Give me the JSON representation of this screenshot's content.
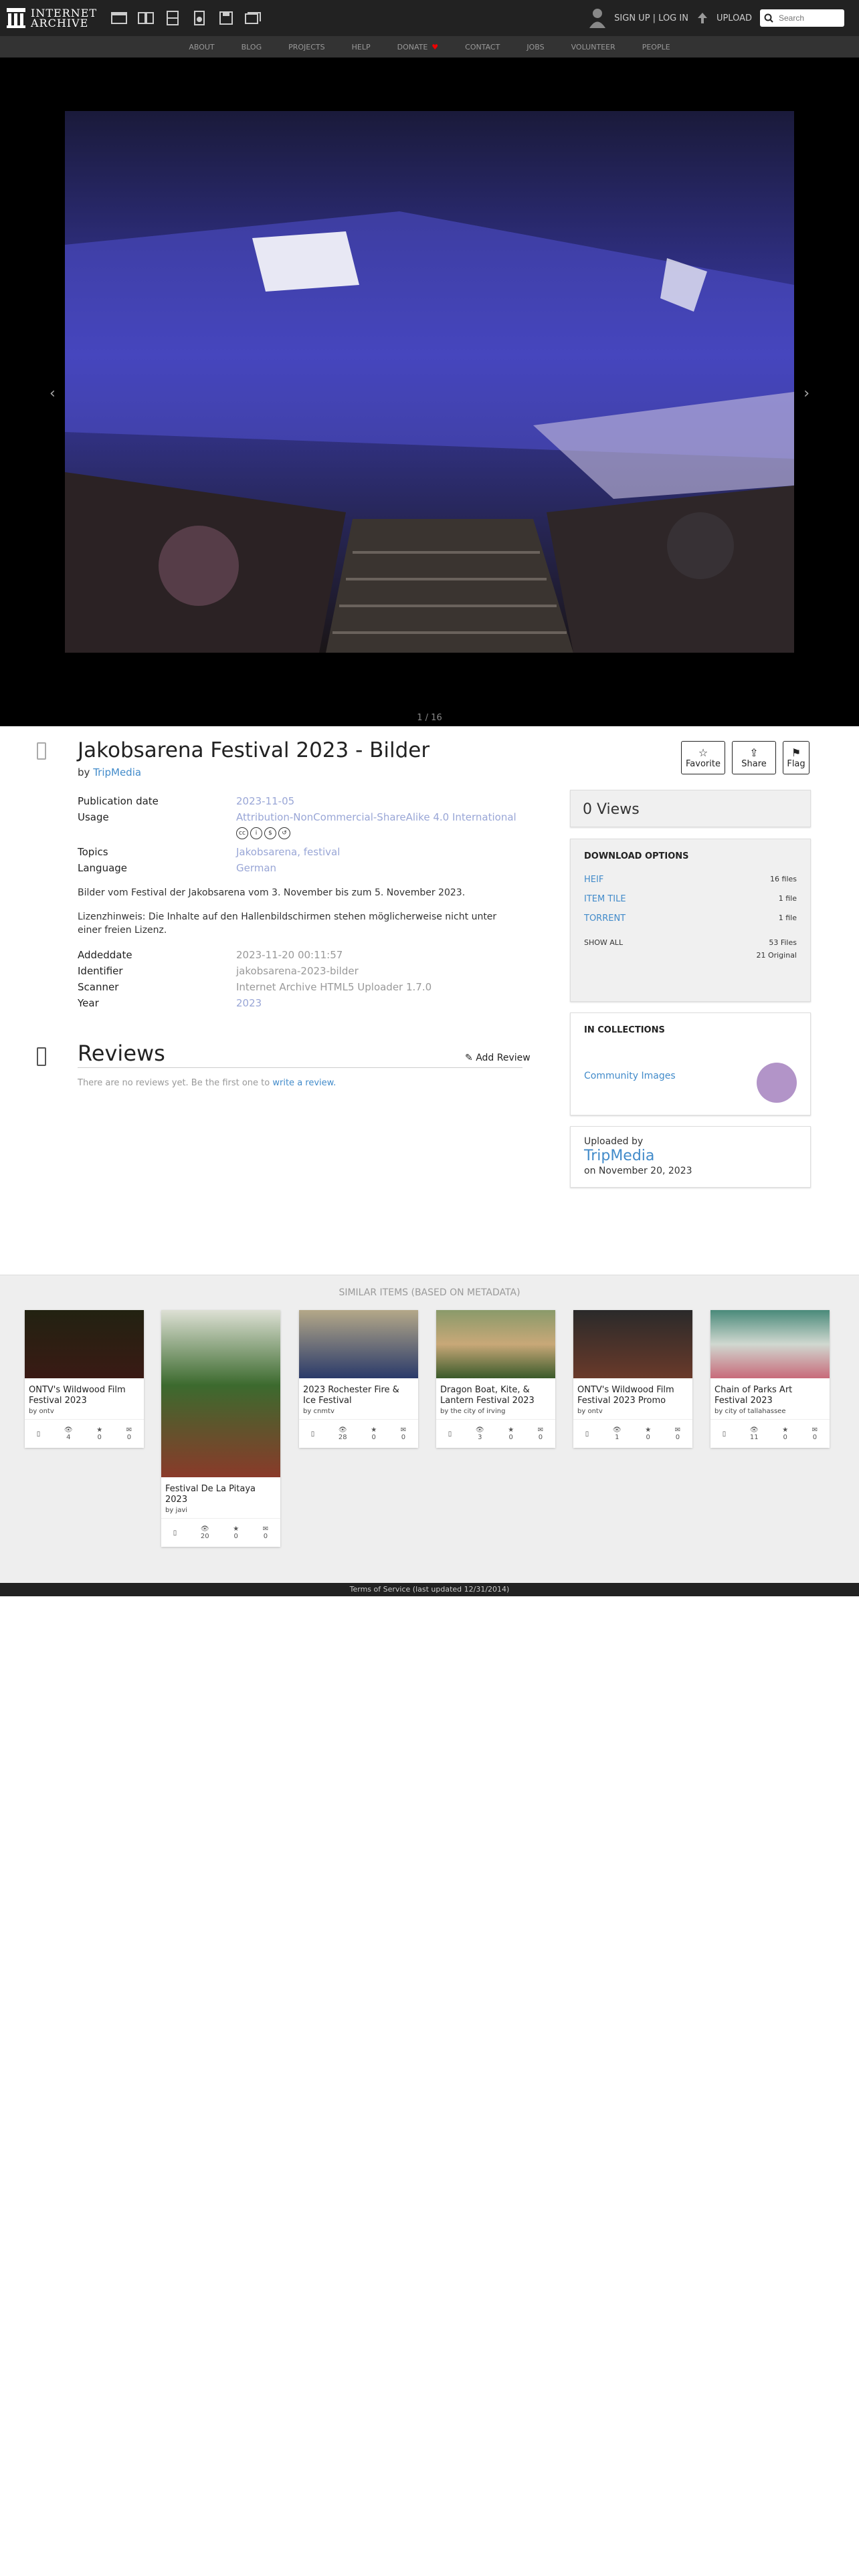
{
  "nav": {
    "logo_line1": "INTERNET",
    "logo_line2": "ARCHIVE",
    "media_icons": [
      "web-icon",
      "texts-icon",
      "video-icon",
      "audio-icon",
      "software-icon",
      "images-icon"
    ],
    "signup": "SIGN UP | LOG IN",
    "upload": "UPLOAD",
    "search_placeholder": "Search"
  },
  "subnav": [
    "ABOUT",
    "BLOG",
    "PROJECTS",
    "HELP",
    "DONATE",
    "CONTACT",
    "JOBS",
    "VOLUNTEER",
    "PEOPLE"
  ],
  "theatre": {
    "counter": "1 / 16"
  },
  "item": {
    "title": "Jakobsarena Festival 2023 - Bilder",
    "by_label": "by",
    "uploader": "TripMedia",
    "favorite": "Favorite",
    "share": "Share",
    "flag": "Flag"
  },
  "metadata": [
    {
      "key": "Publication date",
      "value": "2023-11-05",
      "link": true
    },
    {
      "key": "Usage",
      "value": "Attribution-NonCommercial-ShareAlike 4.0 International",
      "link": true
    }
  ],
  "metadata2": [
    {
      "key": "Topics",
      "value": "Jakobsarena, festival"
    },
    {
      "key": "Language",
      "value": "German"
    }
  ],
  "description": [
    "Bilder vom Festival der Jakobsarena vom 3. November bis zum 5. November 2023.",
    "Lizenzhinweis: Die Inhalte auf den Hallenbildschirmen stehen möglicherweise nicht unter einer freien Lizenz."
  ],
  "metadata3": [
    {
      "key": "Addeddate",
      "value": "2023-11-20 00:11:57"
    },
    {
      "key": "Identifier",
      "value": "jakobsarena-2023-bilder"
    },
    {
      "key": "Scanner",
      "value": "Internet Archive HTML5 Uploader 1.7.0"
    },
    {
      "key": "Year",
      "value": "2023"
    }
  ],
  "reviews": {
    "title": "Reviews",
    "add": "Add Review",
    "none_text": "There are no reviews yet. Be the first one to",
    "write": "write a review."
  },
  "sidebar": {
    "views": "0 Views",
    "download_title": "DOWNLOAD OPTIONS",
    "downloads": [
      {
        "label": "HEIF",
        "count": "16 files"
      },
      {
        "label": "ITEM TILE",
        "count": "1 file"
      },
      {
        "label": "TORRENT",
        "count": "1 file"
      }
    ],
    "show_all": "SHOW ALL",
    "total_files": "53 Files",
    "original": "21 Original",
    "collections_title": "IN COLLECTIONS",
    "collection": "Community Images",
    "uploaded_by": "Uploaded by",
    "uploader": "TripMedia",
    "uploaded_on": "on November 20, 2023"
  },
  "similar": {
    "title": "SIMILAR ITEMS (based on metadata)",
    "cards": [
      {
        "title": "ONTV's Wildwood Film Festival 2023",
        "by": "by ontv",
        "views": "4",
        "favs": "0",
        "reviews": "0"
      },
      {
        "title": "2023 Rochester Fire & Ice Festival",
        "by": "by cnmtv",
        "views": "28",
        "favs": "0",
        "reviews": "0"
      },
      {
        "title": "Dragon Boat, Kite, & Lantern Festival 2023",
        "by": "by the city of irving",
        "views": "3",
        "favs": "0",
        "reviews": "0"
      },
      {
        "title": "ONTV's Wildwood Film Festival 2023 Promo",
        "by": "by ontv",
        "views": "1",
        "favs": "0",
        "reviews": "0"
      },
      {
        "title": "Chain of Parks Art Festival 2023",
        "by": "by city of tallahassee",
        "views": "11",
        "favs": "0",
        "reviews": "0"
      },
      {
        "title": "Festival De La Pitaya 2023",
        "by": "by javi",
        "views": "20",
        "favs": "0",
        "reviews": "0"
      }
    ]
  },
  "footer": "Terms of Service (last updated 12/31/2014)"
}
